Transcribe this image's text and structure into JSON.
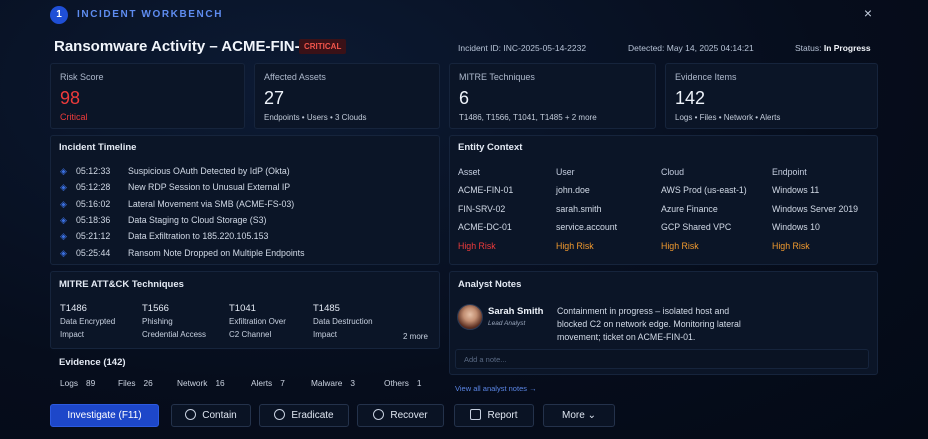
{
  "header": {
    "step": "1",
    "title": "INCIDENT WORKBENCH",
    "close_icon": "×"
  },
  "incident": {
    "title": "Ransomware Activity – ACME-FIN-01",
    "severity": "CRITICAL",
    "id_text": "Incident ID: INC-2025-05-14-2232",
    "detected_text": "Detected: May 14, 2025 04:14:21",
    "status_label": "Status:",
    "status_value": "In Progress"
  },
  "stats": {
    "risk": {
      "label": "Risk Score",
      "value": "98",
      "sub": "Critical"
    },
    "assets": {
      "label": "Affected Assets",
      "value": "27",
      "sub": "Endpoints • Users • 3 Clouds"
    },
    "mitre": {
      "label": "MITRE Techniques",
      "value": "6",
      "sub": "T1486, T1566, T1041, T1485 + 2 more"
    },
    "evidence": {
      "label": "Evidence Items",
      "value": "142",
      "sub": "Logs • Files • Network • Alerts"
    }
  },
  "timeline": {
    "title": "Incident Timeline",
    "events": [
      {
        "time": "05:12:33",
        "text": "Suspicious OAuth Detected by IdP (Okta)"
      },
      {
        "time": "05:12:28",
        "text": "New RDP Session to Unusual External IP"
      },
      {
        "time": "05:16:02",
        "text": "Lateral Movement via SMB (ACME-FS-03)"
      },
      {
        "time": "05:18:36",
        "text": "Data Staging to Cloud Storage (S3)"
      },
      {
        "time": "05:21:12",
        "text": "Data Exfiltration to 185.220.105.153"
      },
      {
        "time": "05:25:44",
        "text": "Ransom Note Dropped on Multiple Endpoints"
      }
    ]
  },
  "entity": {
    "title": "Entity Context",
    "columns": [
      "Asset",
      "User",
      "Cloud",
      "Endpoint"
    ],
    "rows": [
      [
        "ACME-FIN-01",
        "john.doe",
        "AWS Prod (us-east-1)",
        "Windows 11"
      ],
      [
        "FIN-SRV-02",
        "sarah.smith",
        "Azure Finance",
        "Windows Server 2019"
      ],
      [
        "ACME-DC-01",
        "service.account",
        "GCP Shared VPC",
        "Windows 10"
      ]
    ],
    "risk": [
      "High Risk",
      "High Risk",
      "High Risk",
      "High Risk"
    ]
  },
  "attack": {
    "title": "MITRE ATT&CK Techniques",
    "techniques": [
      {
        "id": "T1486",
        "name": "Data Encrypted",
        "name2": "Impact"
      },
      {
        "id": "T1566",
        "name": "Phishing",
        "name2": "Credential Access"
      },
      {
        "id": "T1041",
        "name": "Exfiltration Over",
        "name2": "C2 Channel"
      },
      {
        "id": "T1485",
        "name": "Data Destruction",
        "name2": "Impact"
      }
    ],
    "more": "2 more"
  },
  "evidence": {
    "title": "Evidence (142)",
    "items": [
      {
        "label": "Logs",
        "count": "89"
      },
      {
        "label": "Files",
        "count": "26"
      },
      {
        "label": "Network",
        "count": "16"
      },
      {
        "label": "Alerts",
        "count": "7"
      },
      {
        "label": "Malware",
        "count": "3"
      },
      {
        "label": "Others",
        "count": "1"
      }
    ]
  },
  "notes": {
    "title": "Analyst Notes",
    "author": "Sarah Smith",
    "role": "Lead Analyst",
    "text_lines": [
      "Containment in progress – isolated host and",
      "blocked C2 on network edge. Monitoring lateral",
      "movement; ticket on ACME-FIN-01."
    ],
    "placeholder": "Add a note...",
    "link": "View all analyst notes →"
  },
  "actions": {
    "investigate": "Investigate (F11)",
    "contain": "Contain",
    "eradicate": "Eradicate",
    "recover": "Recover",
    "report": "Report",
    "more": "More ⌄"
  },
  "colors": {
    "accent": "#1d47c9",
    "critical": "#ee3b3b",
    "high_risk_orange": "#f29a2e"
  }
}
